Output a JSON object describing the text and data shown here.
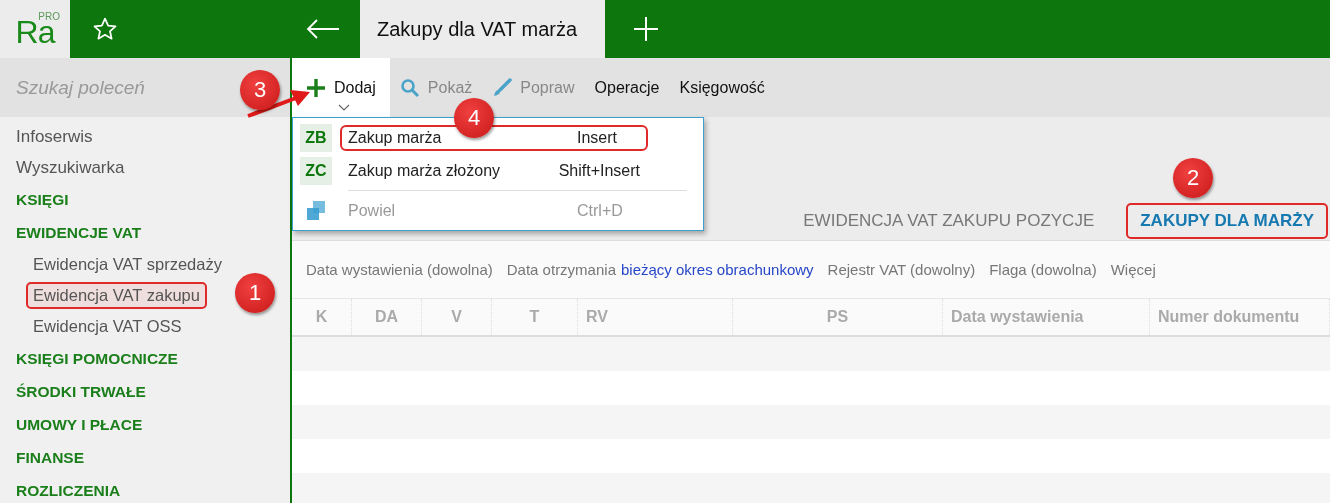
{
  "logo": {
    "text": "Ra",
    "badge": "PRO"
  },
  "tabs": [
    {
      "label": "Zakupy dla VAT marża",
      "selected": true
    }
  ],
  "search": {
    "placeholder": "Szukaj poleceń"
  },
  "toolbar": [
    {
      "label": "Dodaj",
      "disabled": false,
      "active": true
    },
    {
      "label": "Pokaż",
      "disabled": true,
      "active": false
    },
    {
      "label": "Popraw",
      "disabled": true,
      "active": false
    },
    {
      "label": "Operacje",
      "disabled": false,
      "active": false
    },
    {
      "label": "Księgowość",
      "disabled": false,
      "active": false
    }
  ],
  "sidebar": {
    "items": [
      {
        "label": "Infoserwis",
        "kind": "link"
      },
      {
        "label": "Wyszukiwarka",
        "kind": "link"
      },
      {
        "label": "KSIĘGI",
        "kind": "section"
      },
      {
        "label": "EWIDENCJE VAT",
        "kind": "section",
        "children": [
          {
            "label": "Ewidencja VAT sprzedaży",
            "selected": false,
            "outlined": false
          },
          {
            "label": "Ewidencja VAT zakupu",
            "selected": true,
            "outlined": true
          },
          {
            "label": "Ewidencja VAT OSS",
            "selected": false,
            "outlined": false
          }
        ]
      },
      {
        "label": "KSIĘGI POMOCNICZE",
        "kind": "section"
      },
      {
        "label": "ŚRODKI TRWAŁE",
        "kind": "section"
      },
      {
        "label": "UMOWY I PŁACE",
        "kind": "section"
      },
      {
        "label": "FINANSE",
        "kind": "section"
      },
      {
        "label": "ROZLICZENIA",
        "kind": "section"
      }
    ]
  },
  "menu": {
    "items": [
      {
        "code": "ZB",
        "label": "Zakup marża",
        "shortcut": "Insert",
        "disabled": false,
        "outlined": true,
        "separator_before": false
      },
      {
        "code": "ZC",
        "label": "Zakup marża złożony",
        "shortcut": "Shift+Insert",
        "disabled": false,
        "outlined": false,
        "separator_before": false
      },
      {
        "label": "Powiel",
        "shortcut": "Ctrl+D",
        "disabled": true,
        "outlined": false,
        "separator_before": true
      }
    ]
  },
  "view_tabs": [
    {
      "label": "EWIDENCJA VAT ZAKUPU POZYCJE",
      "selected": false,
      "outlined": false
    },
    {
      "label": "ZAKUPY DLA MARŻY",
      "selected": true,
      "outlined": true
    }
  ],
  "filters": [
    {
      "label": "Data wystawienia (dowolna)"
    },
    {
      "label": "Data otrzymania",
      "value": "bieżący okres obrachunkowy"
    },
    {
      "label": "Rejestr VAT (dowolny)"
    },
    {
      "label": "Flaga (dowolna)"
    },
    {
      "label": "Więcej"
    }
  ],
  "table": {
    "columns": [
      "K",
      "DA",
      "V",
      "T",
      "RV",
      "PS",
      "Data wystawienia",
      "Numer dokumentu"
    ]
  },
  "annotations": [
    {
      "label": "1"
    },
    {
      "label": "2"
    },
    {
      "label": "3"
    },
    {
      "label": "4"
    }
  ]
}
